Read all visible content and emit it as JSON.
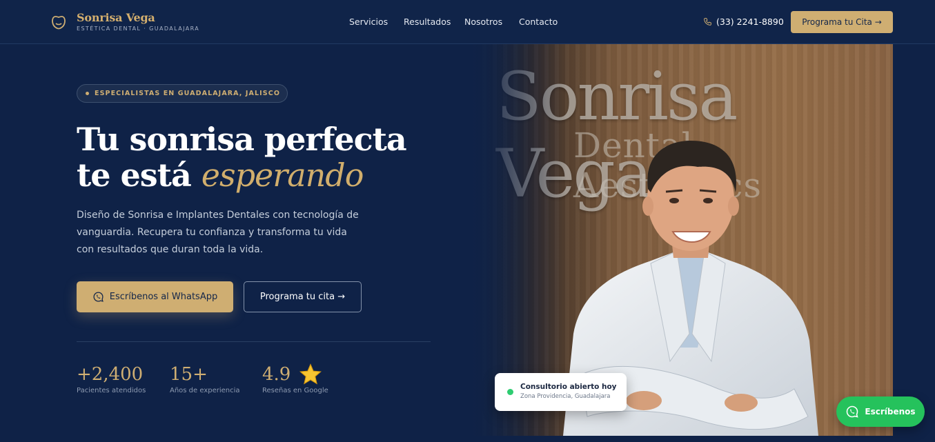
{
  "header": {
    "logo_icon": "tooth-icon",
    "brand_name": "Sonrisa Vega",
    "brand_tagline": "ESTÉTICA DENTAL · GUADALAJARA",
    "nav": [
      "Servicios",
      "Resultados",
      "Nosotros",
      "Contacto"
    ],
    "phone_icon": "phone-icon",
    "phone": "(33) 2241-8890",
    "cta": "Programa tu Cita →"
  },
  "hero": {
    "badge": "ESPECIALISTAS EN GUADALAJARA, JALISCO",
    "title_line1": "Tu sonrisa perfecta",
    "title_line2_prefix": "te está ",
    "title_line2_accent": "esperando",
    "lead": "Diseño de Sonrisa e Implantes Dentales con tecnología de vanguardia. Recupera tu confianza y transforma tu vida con resultados que duran toda la vida.",
    "primary_button": "Escríbenos al WhatsApp",
    "primary_button_icon": "whatsapp-icon",
    "secondary_button": "Programa tu cita →",
    "stats": [
      {
        "value": "+2,400",
        "label": "Pacientes atendidos"
      },
      {
        "value": "15+",
        "label": "Años de experiencia"
      },
      {
        "value": "4.9",
        "label": "Reseñas en Google",
        "icon": "star-icon"
      }
    ]
  },
  "photo": {
    "sign_text": "Sonrisa Vega",
    "sign_subtext": "Dental Aesthetics",
    "status_title": "Consultorio abierto hoy",
    "status_location": "Zona Providencia, Guadalajara"
  },
  "floating_whatsapp": {
    "label": "Escríbenos",
    "icon": "whatsapp-icon"
  },
  "colors": {
    "background": "#0f2247",
    "gold": "#cfae72",
    "whatsapp": "#25c25c"
  }
}
